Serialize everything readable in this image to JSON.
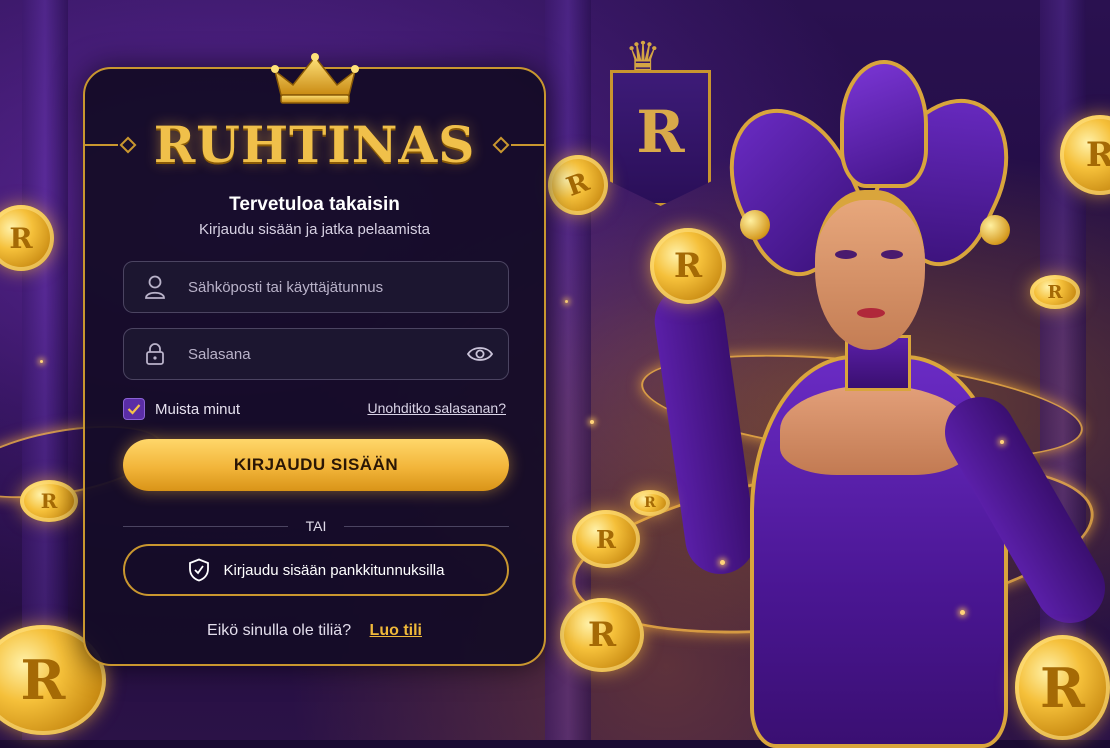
{
  "brand": {
    "name": "RUHTINAS"
  },
  "background": {
    "banner_letter": "R",
    "coin_letter": "R"
  },
  "login": {
    "title": "Tervetuloa takaisin",
    "subtitle": "Kirjaudu sisään ja jatka pelaamista",
    "username_placeholder": "Sähköposti tai käyttäjätunnus",
    "username_value": "",
    "password_placeholder": "Salasana",
    "password_value": "",
    "remember_label": "Muista minut",
    "remember_checked": true,
    "forgot_link": "Unohditko salasanan?",
    "submit_label": "KIRJAUDU SISÄÄN",
    "divider_label": "TAI",
    "bank_login_label": "Kirjaudu sisään pankkitunnuksilla",
    "signup_prompt": "Eikö sinulla ole tiliä?",
    "signup_link": "Luo tili"
  },
  "icons": {
    "crown": "crown-icon",
    "user": "user-icon",
    "lock": "lock-icon",
    "eye": "eye-icon",
    "check": "check-icon",
    "shield": "shield-icon"
  },
  "colors": {
    "gold": "#f0c04a",
    "button_gold": "#f2b53a",
    "card_bg": "#140c26",
    "purple_accent": "#5a2da6",
    "link_gold": "#f0b93a"
  }
}
